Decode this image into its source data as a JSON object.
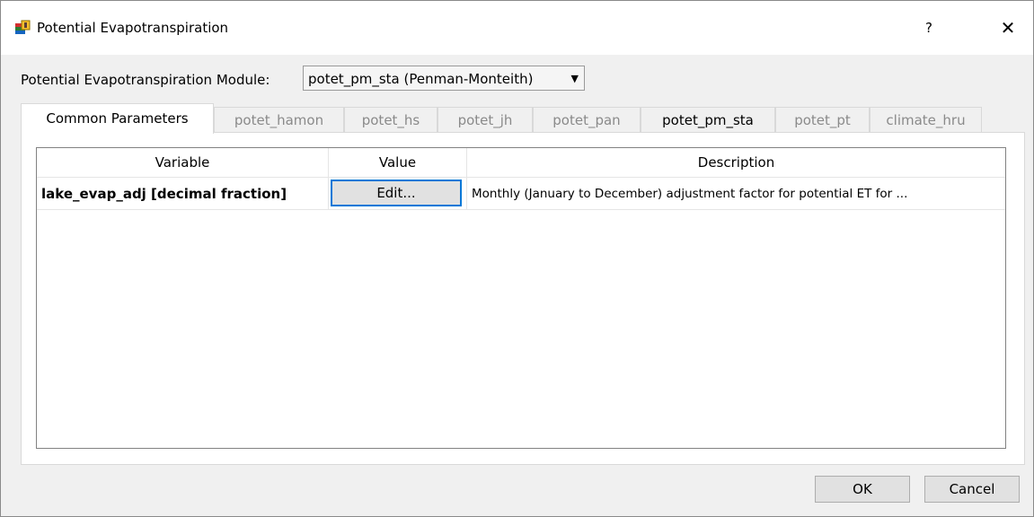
{
  "window": {
    "title": "Potential Evapotranspiration",
    "help_label": "?",
    "close_label": "✕"
  },
  "module": {
    "label": "Potential Evapotranspiration Module:",
    "selected": "potet_pm_sta (Penman-Monteith)",
    "arrow": "▼"
  },
  "tabs": [
    {
      "label": "Common Parameters",
      "active": true
    },
    {
      "label": "potet_hamon",
      "active": false
    },
    {
      "label": "potet_hs",
      "active": false
    },
    {
      "label": "potet_jh",
      "active": false
    },
    {
      "label": "potet_pan",
      "active": false
    },
    {
      "label": "potet_pm_sta",
      "active": false
    },
    {
      "label": "potet_pt",
      "active": false
    },
    {
      "label": "climate_hru",
      "active": false
    }
  ],
  "table": {
    "headers": [
      "Variable",
      "Value",
      "Description"
    ],
    "rows": [
      {
        "variable": "lake_evap_adj [decimal fraction]",
        "value_button": "Edit...",
        "description": "Monthly (January to December) adjustment factor for potential ET for ..."
      }
    ]
  },
  "buttons": {
    "ok": "OK",
    "cancel": "Cancel"
  },
  "colors": {
    "focus_border": "#0078d7",
    "button_bg": "#e1e1e1",
    "dialog_bg": "#f0f0f0"
  }
}
